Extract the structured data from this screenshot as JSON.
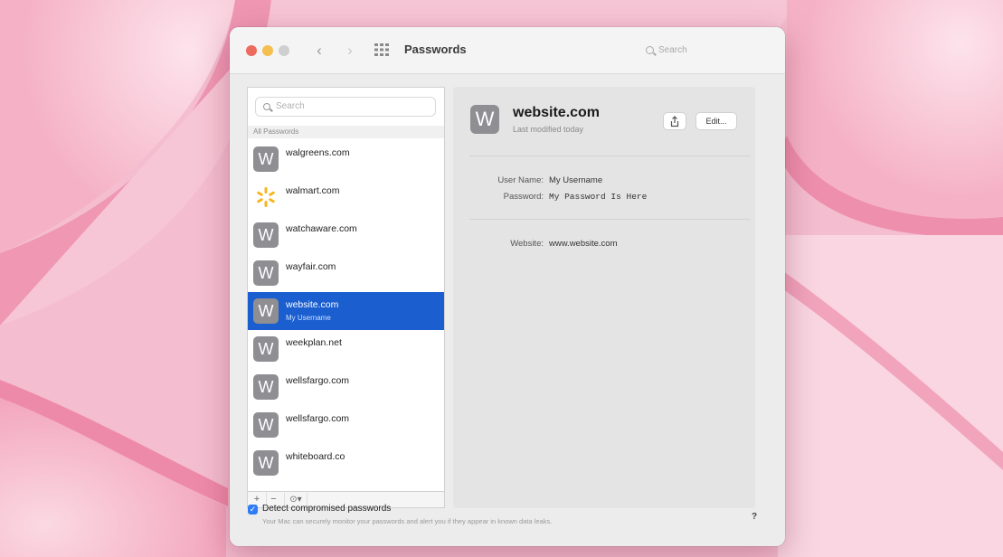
{
  "window": {
    "title": "Passwords",
    "nav_back": "‹",
    "nav_forward": "›"
  },
  "search": {
    "top_placeholder": "Search",
    "sidebar_placeholder": "Search"
  },
  "sidebar": {
    "section_label": "All Passwords",
    "items": [
      {
        "site": "walgreens.com",
        "avatar": "W",
        "icon": "letter-avatar-icon"
      },
      {
        "site": "walmart.com",
        "avatar": "",
        "icon": "walmart-spark-icon"
      },
      {
        "site": "watchaware.com",
        "avatar": "W",
        "icon": "letter-avatar-icon"
      },
      {
        "site": "wayfair.com",
        "avatar": "W",
        "icon": "letter-avatar-icon"
      },
      {
        "site": "website.com",
        "user": "My Username",
        "avatar": "W",
        "icon": "letter-avatar-icon",
        "selected": true
      },
      {
        "site": "weekplan.net",
        "avatar": "W",
        "icon": "letter-avatar-icon"
      },
      {
        "site": "wellsfargo.com",
        "avatar": "W",
        "icon": "letter-avatar-icon"
      },
      {
        "site": "wellsfargo.com",
        "avatar": "W",
        "icon": "letter-avatar-icon"
      },
      {
        "site": "whiteboard.co",
        "avatar": "W",
        "icon": "letter-avatar-icon"
      }
    ],
    "toolbar": {
      "add": "+",
      "remove": "−",
      "more": "⊙▾"
    }
  },
  "detail": {
    "avatar": "W",
    "title": "website.com",
    "subtitle": "Last modified today",
    "share_icon": "share-icon",
    "edit_label": "Edit...",
    "username_label": "User Name:",
    "username_value": "My Username",
    "password_label": "Password:",
    "password_value": "My Password Is Here",
    "website_label": "Website:",
    "website_value": "www.website.com"
  },
  "footer": {
    "checkbox_checked": true,
    "title": "Detect compromised passwords",
    "description": "Your Mac can securely monitor your passwords and alert you if they appear in known data leaks.",
    "help": "?"
  },
  "colors": {
    "accent": "#1b5ecf",
    "checkbox": "#2f7cf6",
    "close": "#ed6a5e",
    "minimize": "#f5bf4f",
    "wallpaper": "#f6c9d8"
  }
}
